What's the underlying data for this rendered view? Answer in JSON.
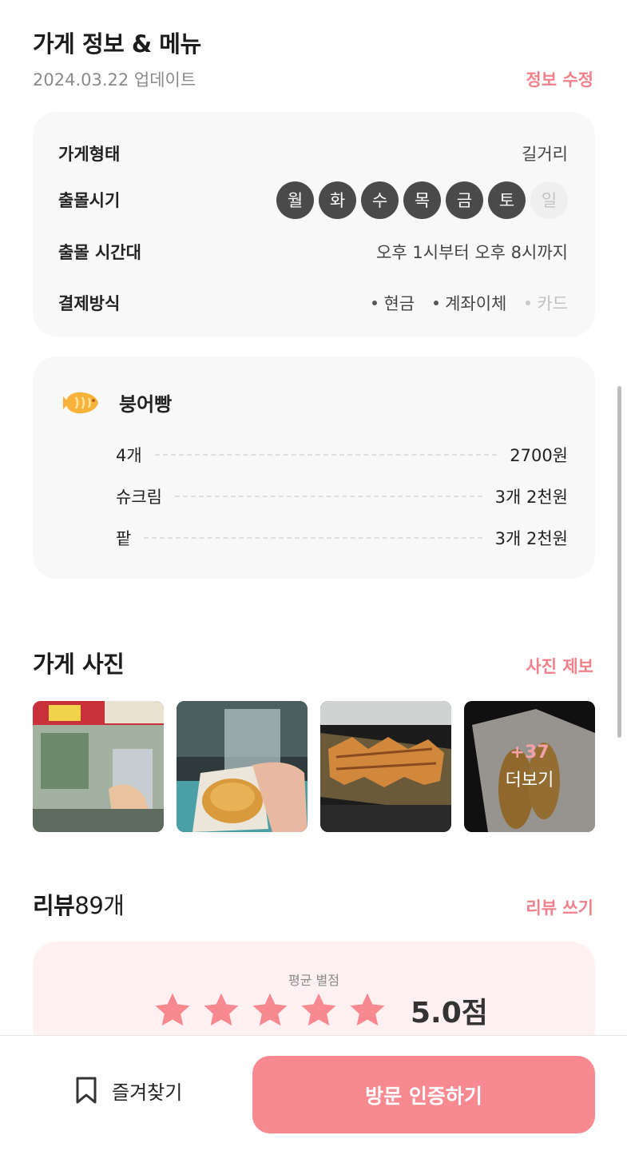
{
  "store_info": {
    "title": "가게 정보 & 메뉴",
    "updated": "2024.03.22 업데이트",
    "edit_label": "정보 수정",
    "rows": {
      "type_label": "가게형태",
      "type_value": "길거리",
      "days_label": "출몰시기",
      "days": [
        {
          "label": "월",
          "active": true
        },
        {
          "label": "화",
          "active": true
        },
        {
          "label": "수",
          "active": true
        },
        {
          "label": "목",
          "active": true
        },
        {
          "label": "금",
          "active": true
        },
        {
          "label": "토",
          "active": true
        },
        {
          "label": "일",
          "active": false
        }
      ],
      "hours_label": "출몰 시간대",
      "hours_value": "오후 1시부터 오후 8시까지",
      "payment_label": "결제방식",
      "payments": [
        {
          "label": "현금",
          "active": true
        },
        {
          "label": "계좌이체",
          "active": true
        },
        {
          "label": "카드",
          "active": false
        }
      ]
    }
  },
  "menu": {
    "category_icon": "bungeoppang-icon",
    "category": "붕어빵",
    "items": [
      {
        "name": "4개",
        "price": "2700원"
      },
      {
        "name": "슈크림",
        "price": "3개 2천원"
      },
      {
        "name": "팥",
        "price": "3개 2천원"
      }
    ]
  },
  "photos": {
    "title": "가게 사진",
    "report_label": "사진 제보",
    "more_count": "+37",
    "more_label": "더보기"
  },
  "reviews": {
    "title": "리뷰",
    "count": "89개",
    "write_label": "리뷰 쓰기",
    "avg_label": "평균 별점",
    "stars": 5,
    "score": "5.0점"
  },
  "bottom": {
    "favorite_label": "즐겨찾기",
    "visit_label": "방문 인증하기"
  },
  "colors": {
    "accent": "#f88990",
    "link": "#f0808a",
    "star": "#f88990"
  }
}
